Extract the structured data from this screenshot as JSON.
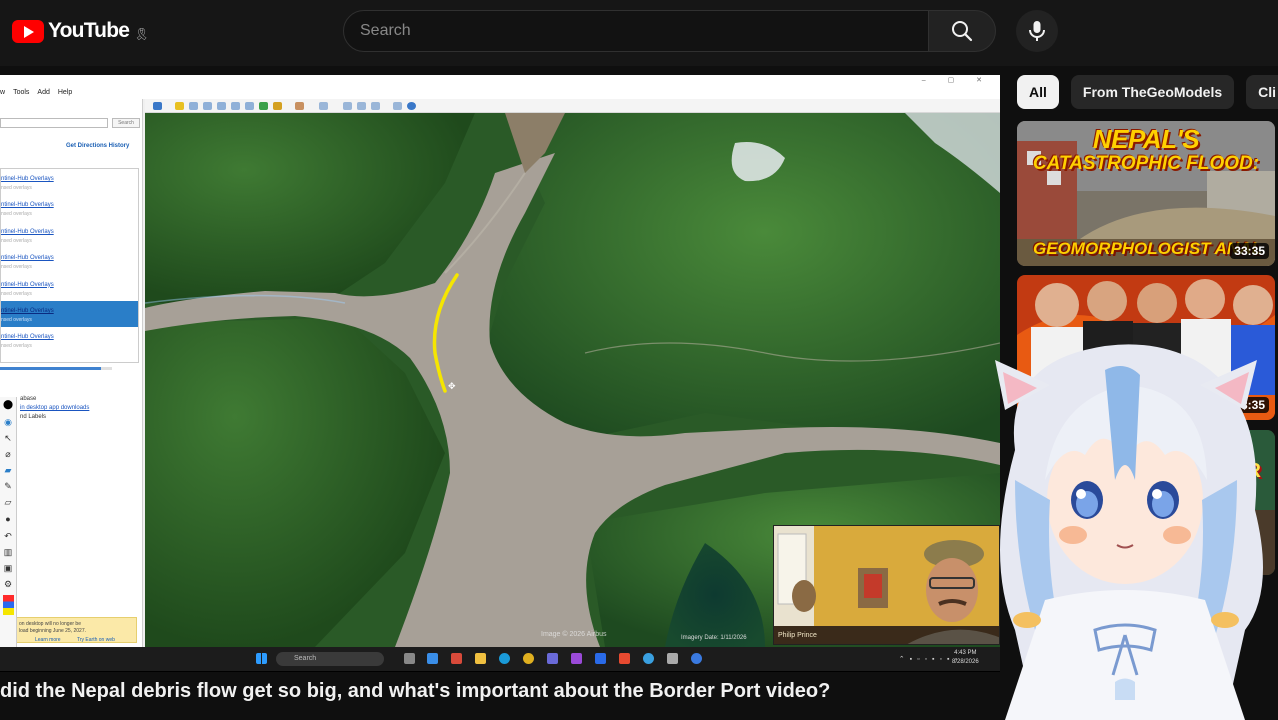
{
  "masthead": {
    "logo_text": "YouTube",
    "logo_badge": "🎗",
    "search_placeholder": "Search"
  },
  "colors": {
    "brand_red": "#ff0000",
    "background": "#0f0f0f",
    "chip_active": "#f1f1f1",
    "annotation_yellow": "#f5e600"
  },
  "player": {
    "app": {
      "menu": [
        "w",
        "Tools",
        "Add",
        "Help"
      ],
      "left_panel": {
        "search_button": "Search",
        "links": "Get Directions   History",
        "list_items": [
          {
            "title": "ntinel-Hub Overlays",
            "sub": "nsed overlays"
          },
          {
            "title": "ntinel-Hub Overlays",
            "sub": "nsed overlays"
          },
          {
            "title": "ntinel-Hub Overlays",
            "sub": "nsed overlays"
          },
          {
            "title": "ntinel-Hub Overlays",
            "sub": "nsed overlays"
          },
          {
            "title": "ntinel-Hub Overlays",
            "sub": "nsed overlays"
          },
          {
            "title": "ntinel-Hub Overlays",
            "sub": "nsed overlays",
            "selected": true
          },
          {
            "title": "ntinel-Hub Overlays",
            "sub": "nsed overlays"
          }
        ],
        "layers": [
          "abase",
          "in desktop app downloads",
          "nd Labels"
        ],
        "notice_line1": "on desktop will no longer be",
        "notice_line2": "load beginning June 25, 2027.",
        "notice_learn": "Learn more",
        "notice_try": "Try Earth on web"
      },
      "map_credit": "Image © 2026 Airbus",
      "imagery_date": "Imagery Date: 1/11/2026",
      "taskbar_search": "Search",
      "clock_time": "4:43 PM",
      "clock_date": "8/28/2026"
    },
    "webcam_name": "Philip Prince"
  },
  "video_title": "did the Nepal debris flow get so big, and what's important about the Border Port video?",
  "chips": [
    "All",
    "From TheGeoModels",
    "Cli"
  ],
  "recommendations": [
    {
      "thumb_line1": "NEPAL'S",
      "thumb_line2": "CATASTROPHIC FLOOD:",
      "thumb_line3": "GEOMORPHOLOGIST ANAL",
      "duration": "33:35"
    },
    {
      "duration": "33:35"
    },
    {
      "thumb_word": "TER"
    }
  ]
}
